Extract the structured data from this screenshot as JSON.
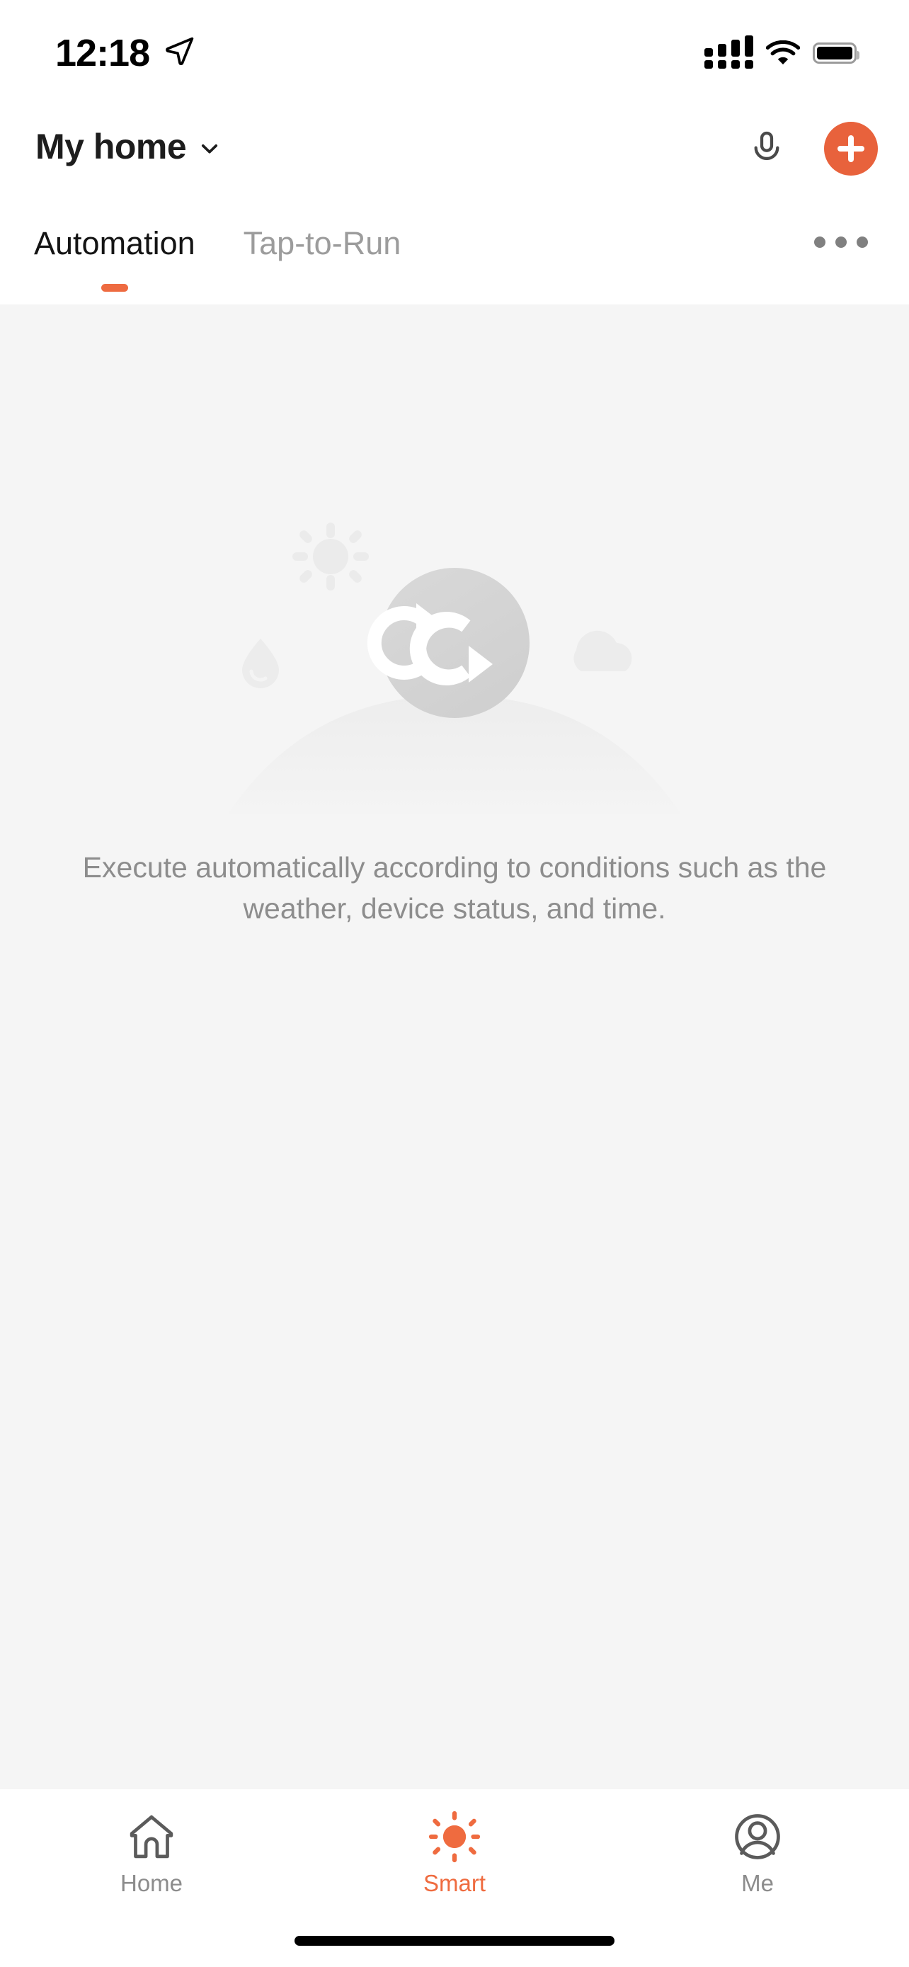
{
  "status_bar": {
    "time": "12:18",
    "location_icon": "location-arrow-icon",
    "cellular_icon": "cellular-signal-icon",
    "wifi_icon": "wifi-icon",
    "battery_icon": "battery-full-icon"
  },
  "header": {
    "home_name": "My home",
    "dropdown_icon": "chevron-down-icon",
    "voice_icon": "microphone-icon",
    "add_icon": "plus-icon",
    "accent_color": "#e8623c"
  },
  "tabs": {
    "items": [
      {
        "label": "Automation",
        "active": true
      },
      {
        "label": "Tap-to-Run",
        "active": false
      }
    ],
    "overflow_icon": "more-horizontal-icon",
    "indicator_color": "#ee6b41"
  },
  "empty_state": {
    "illustration_icon": "automation-loop-icon",
    "decor_icons": [
      "sun-icon",
      "water-drop-icon",
      "cloud-icon",
      "hill-icon"
    ],
    "description": "Execute automatically according to conditions such as the weather, device status, and time."
  },
  "bottom_nav": {
    "items": [
      {
        "label": "Home",
        "icon": "house-icon",
        "active": false
      },
      {
        "label": "Smart",
        "icon": "sun-icon",
        "active": true
      },
      {
        "label": "Me",
        "icon": "account-icon",
        "active": false
      }
    ],
    "active_color": "#ef6b3f",
    "inactive_color": "#8c8c8c"
  },
  "home_indicator": "home-indicator-bar"
}
